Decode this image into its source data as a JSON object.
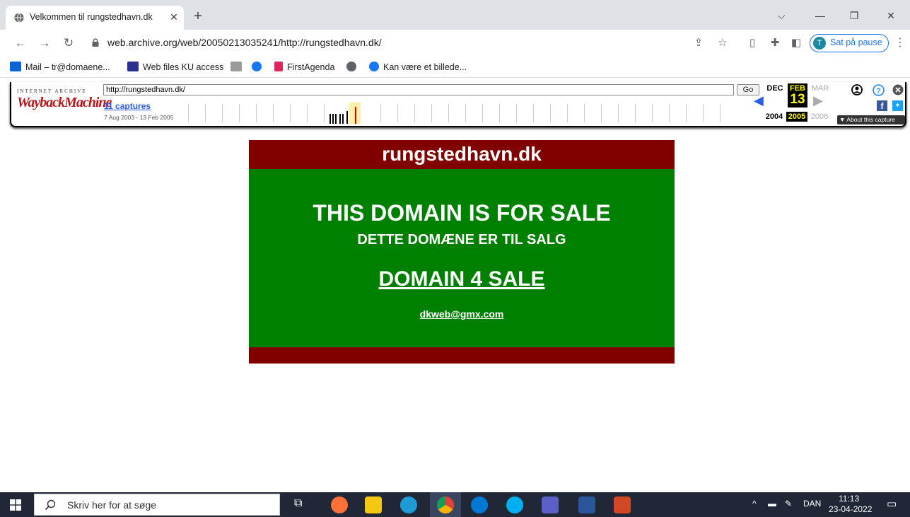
{
  "browser": {
    "tab_title": "Velkommen til rungstedhavn.dk",
    "tab_close": "✕",
    "new_tab": "+",
    "url": "web.archive.org/web/20050213035241/http://rungstedhavn.dk/",
    "profile_initial": "T",
    "profile_status": "Sat på pause",
    "bookmarks": [
      {
        "label": "Mail – tr@domaene...",
        "color": "#0a64d6"
      },
      {
        "label": "Web files KU access",
        "color": "#2b2f8f"
      },
      {
        "label": "",
        "color": "#888888"
      },
      {
        "label": "",
        "color": "#1877f2"
      },
      {
        "label": "FirstAgenda",
        "color": "#e0245e"
      },
      {
        "label": "",
        "color": "#5f6368"
      },
      {
        "label": "Kan være et billede...",
        "color": "#1877f2"
      }
    ]
  },
  "wayback": {
    "ia_label": "INTERNET ARCHIVE",
    "logo_text": "WaybackMachine",
    "url_value": "http://rungstedhavn.dk/",
    "go_label": "Go",
    "captures_label": "11 captures",
    "capture_range": "7 Aug 2003 - 13 Feb 2005",
    "prev_month": "DEC",
    "cur_month": "FEB",
    "next_month": "MAR",
    "day": "13",
    "prev_year": "2004",
    "cur_year": "2005",
    "next_year": "2006",
    "about_label": "▼ About this capture"
  },
  "page": {
    "site_title": "rungstedhavn.dk",
    "headline": "THIS DOMAIN IS FOR SALE",
    "subheadline": "DETTE DOMÆNE ER  TIL SALG",
    "link_sale": "DOMAIN 4 SALE",
    "email": "dkweb@gmx.com",
    "colors": {
      "banner": "#800000",
      "body": "#008000"
    }
  },
  "taskbar": {
    "search_placeholder": "Skriv her for at søge",
    "language": "DAN",
    "time": "11:13",
    "date": "23-04-2022"
  }
}
